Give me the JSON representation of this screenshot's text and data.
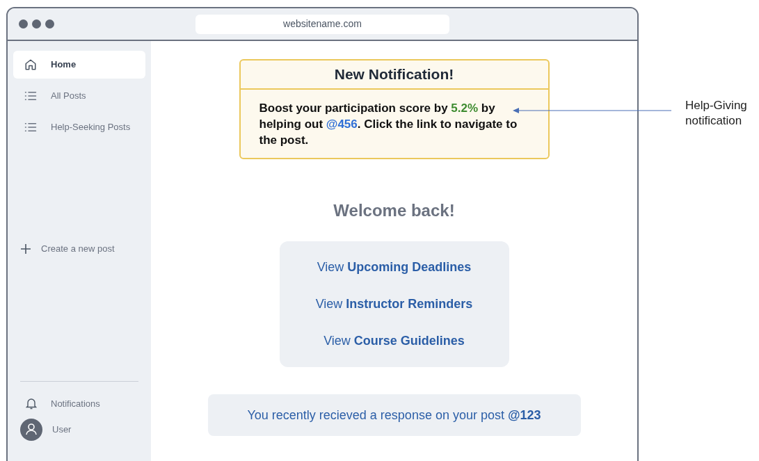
{
  "browser": {
    "address": "websitename.com"
  },
  "sidebar": {
    "items": [
      {
        "label": "Home",
        "selected": true
      },
      {
        "label": "All Posts",
        "selected": false
      },
      {
        "label": "Help-Seeking Posts",
        "selected": false
      }
    ],
    "create_post": "Create a new post",
    "notifications": "Notifications",
    "user": "User"
  },
  "notification": {
    "title": "New Notification!",
    "body": [
      {
        "kind": "text",
        "text": "Boost your participation score by "
      },
      {
        "kind": "highlight",
        "text": "5.2%"
      },
      {
        "kind": "text",
        "text": " by helping out "
      },
      {
        "kind": "link",
        "text": "@456"
      },
      {
        "kind": "text",
        "text": ". Click the link to navigate to the post."
      }
    ]
  },
  "welcome": "Welcome back!",
  "links": [
    "View **Upcoming Deadlines**",
    "View **Instructor Reminders**",
    "View **Course Guidelines**"
  ],
  "recent_response": "You recently recieved a response on your post **@123**",
  "annotation": "Help-Giving notification"
}
